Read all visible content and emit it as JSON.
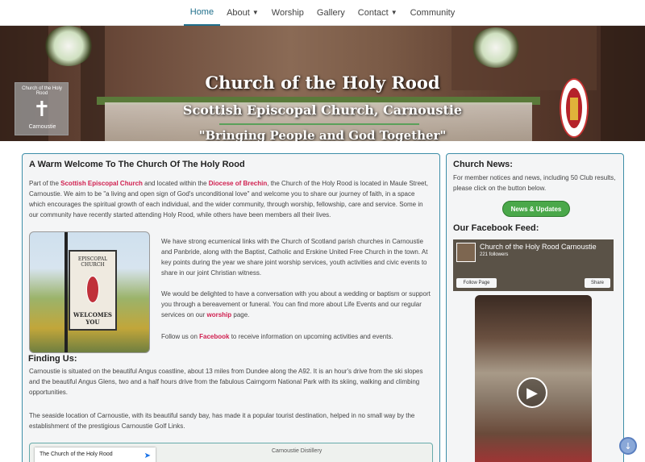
{
  "nav": {
    "items": [
      {
        "label": "Home",
        "caret": false
      },
      {
        "label": "About",
        "caret": true
      },
      {
        "label": "Worship",
        "caret": false
      },
      {
        "label": "Gallery",
        "caret": false
      },
      {
        "label": "Contact",
        "caret": true
      },
      {
        "label": "Community",
        "caret": false
      }
    ],
    "active_index": 0
  },
  "banner": {
    "title": "Church of the Holy Rood",
    "subtitle": "Scottish Episcopal Church, Carnoustie",
    "tagline": "\"Bringing People and God Together\"",
    "logo_ring_text": "Church of the Holy Rood",
    "logo_text": "Carnoustie"
  },
  "main": {
    "heading": "A Warm Welcome To The Church Of The Holy Rood",
    "intro": {
      "t1": "Part of the ",
      "link1": "Scottish Episcopal Church",
      "t2": " and located within the ",
      "link2": "Diocese of Brechin",
      "t3": ", the Church of the Holy Rood is located in Maule Street, Carnoustie. We aim to be \"a living and open sign of God's unconditional love\" and welcome you to share our journey of faith, in a space which encourages the spiritual growth of each individual, and the wider community, through worship, fellowship, care and service. Some in our community have recently started attending Holy Rood, while others have been members all their lives."
    },
    "photo": {
      "sign_top": "EPISCOPAL CHURCH",
      "sign_bottom": "WELCOMES YOU"
    },
    "ecumenical": "We have strong ecumenical links with the Church of Scotland parish churches in Carnoustie and Panbride, along with the Baptist, Catholic and Erskine United Free Church in the town.  At key points during the year we share joint worship services, youth activities and civic events to share in our joint Christian witness.",
    "conversation": {
      "t1": "We would be delighted to have a conversation with you about a wedding or baptism or support you through a bereavement or funeral. You can find more about Life Events and our regular services on our ",
      "link": "worship",
      "t2": " page."
    },
    "follow": {
      "t1": "Follow us on ",
      "link": "Facebook",
      "t2": " to receive information on upcoming activities and events."
    },
    "finding_heading": "Finding Us:",
    "finding_p1": "Carnoustie is situated on the beautiful Angus coastline, about 13 miles from Dundee along the A92. It is an hour's drive from the ski slopes and the beautiful Angus Glens, two and a half hours drive from the fabulous Cairngorm National Park with its skiing, walking and climbing opportunities.",
    "finding_p2": "The seaside location of Carnoustie, with its beautiful sandy bay, has made it a popular tourist destination, helped in no small way by the establishment of the prestigious Carnoustie Golf Links.",
    "map": {
      "card_title": "The Church of the Holy Rood",
      "label": "Carnoustie Distillery"
    }
  },
  "side": {
    "news_heading": "Church News:",
    "news_text": "For member notices and news, including 50 Club results, please click on the button below.",
    "news_button": "News & Updates",
    "fb_heading": "Our Facebook Feed:",
    "fb": {
      "name": "Church of the Holy Rood Carnoustie",
      "followers": "221 followers",
      "follow_label": "Follow Page",
      "share_label": "Share"
    }
  },
  "colors": {
    "accent": "#1f6f8b",
    "link": "#d02050",
    "button": "#4aa84a",
    "card_border": "#3d8ea8"
  }
}
